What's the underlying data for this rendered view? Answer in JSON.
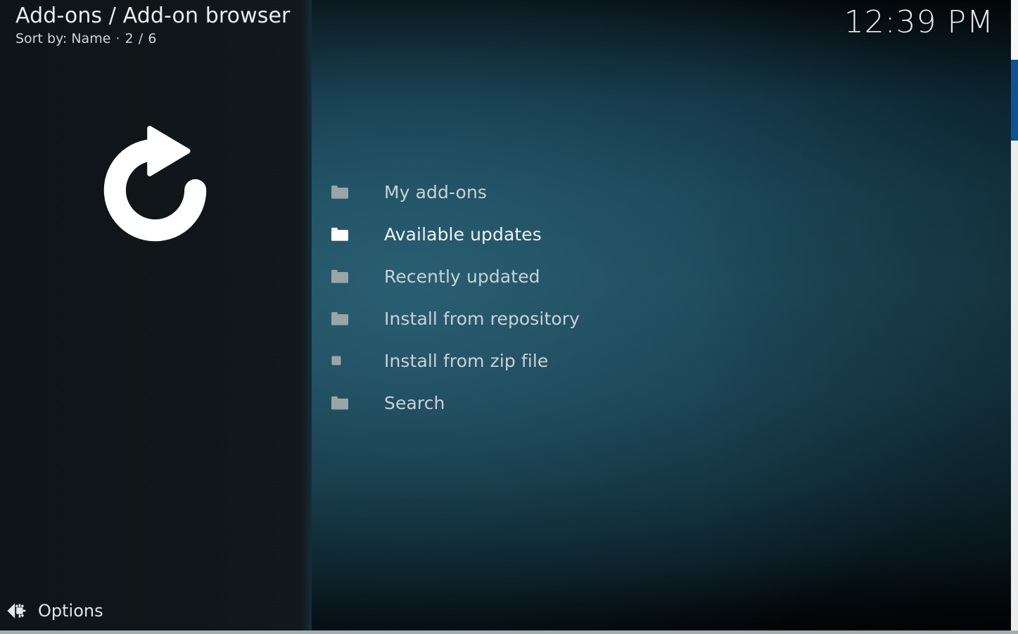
{
  "window": {
    "title": "Add-ons / Add-on browser",
    "sort_label": "Sort by: Name",
    "separator": "·",
    "position_count": "2 / 6",
    "clock": "12:39 PM"
  },
  "left_panel": {
    "hero_icon": "refresh-arrow-icon",
    "options": {
      "label": "Options",
      "icon": "chevron-left-gear-icon"
    }
  },
  "main": {
    "items": [
      {
        "label": "My add-ons",
        "icon": "folder-icon",
        "selected": false
      },
      {
        "label": "Available updates",
        "icon": "folder-icon",
        "selected": true
      },
      {
        "label": "Recently updated",
        "icon": "folder-icon",
        "selected": false
      },
      {
        "label": "Install from repository",
        "icon": "folder-icon",
        "selected": false
      },
      {
        "label": "Install from zip file",
        "icon": "file-square-icon",
        "selected": false
      },
      {
        "label": "Search",
        "icon": "folder-icon",
        "selected": false
      }
    ]
  },
  "scrollbar": {
    "name": "vertical-scrollbar",
    "thumb_color": "#0b5394",
    "track_color": "#ececec"
  },
  "colors": {
    "left_panel_bg": "#11181c",
    "main_accent": "#1e4a5a",
    "folder_grey": "#9aa5a8",
    "folder_white": "#ffffff",
    "text_primary": "#e9edef",
    "text_secondary": "#c9d2d6"
  }
}
